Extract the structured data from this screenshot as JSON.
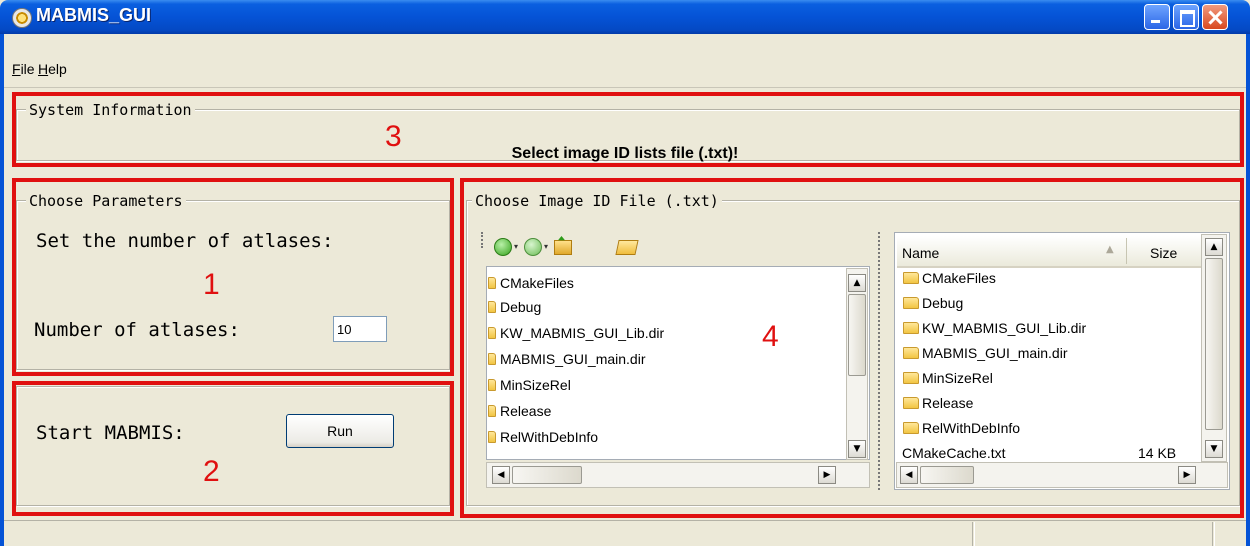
{
  "window": {
    "title": "MABMIS_GUI"
  },
  "menu": {
    "file": "File",
    "help": "Help"
  },
  "system_info": {
    "title": "System Information",
    "message": "Select image ID lists file (.txt)!",
    "annotation": "3"
  },
  "parameters": {
    "title": "Choose Parameters",
    "heading": "Set the number of atlases:",
    "label": "Number of atlases:",
    "value": "10",
    "annotation": "1"
  },
  "start": {
    "label": "Start MABMIS:",
    "run_button": "Run",
    "annotation": "2"
  },
  "file_chooser": {
    "title": "Choose Image ID File (.txt)",
    "annotation": "4",
    "tree_items": [
      "CMakeFiles",
      "Debug",
      "KW_MABMIS_GUI_Lib.dir",
      "MABMIS_GUI_main.dir",
      "MinSizeRel",
      "Release",
      "RelWithDebInfo"
    ],
    "list_columns": {
      "name": "Name",
      "size": "Size"
    },
    "list_items": [
      {
        "name": "CMakeFiles",
        "size": ""
      },
      {
        "name": "Debug",
        "size": ""
      },
      {
        "name": "KW_MABMIS_GUI_Lib.dir",
        "size": ""
      },
      {
        "name": "MABMIS_GUI_main.dir",
        "size": ""
      },
      {
        "name": "MinSizeRel",
        "size": ""
      },
      {
        "name": "Release",
        "size": ""
      },
      {
        "name": "RelWithDebInfo",
        "size": ""
      },
      {
        "name": "CMakeCache.txt",
        "size": "14 KB"
      }
    ],
    "toolbar_icons": [
      "back-icon",
      "forward-icon",
      "up-folder-icon",
      "open-folder-icon"
    ]
  },
  "colors": {
    "highlight": "#e01010",
    "titlebar": "#0553d6"
  }
}
